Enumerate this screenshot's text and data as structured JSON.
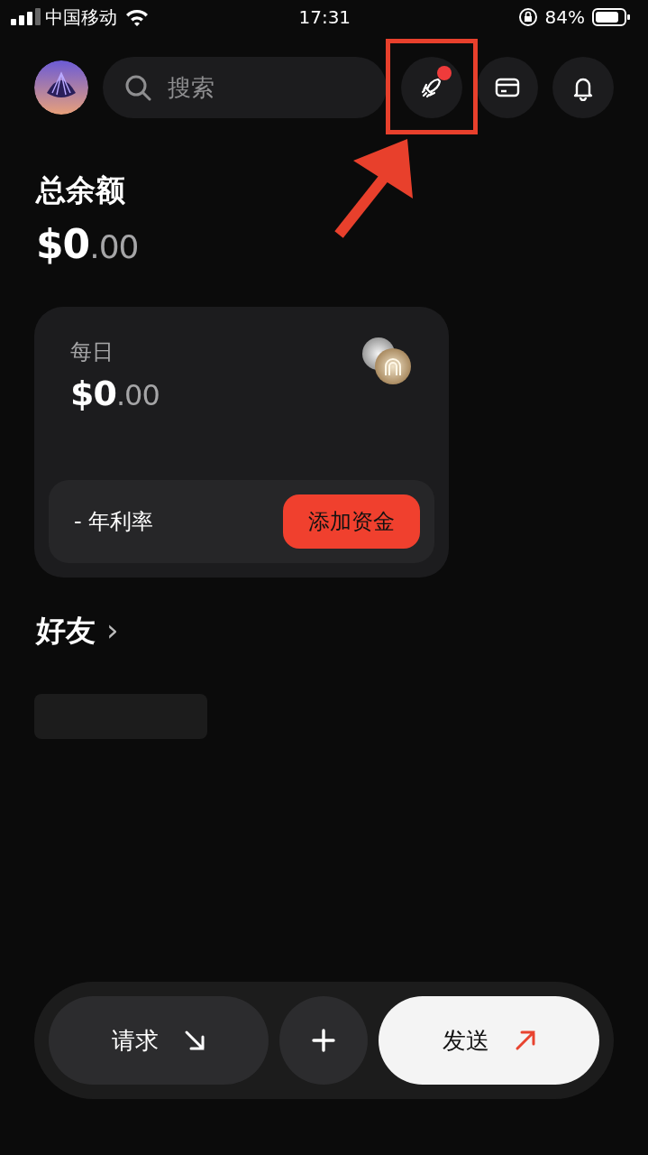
{
  "status_bar": {
    "carrier": "中国移动",
    "time": "17:31",
    "battery": "84%"
  },
  "header": {
    "search": {
      "placeholder": "搜索"
    },
    "icons": [
      {
        "kind": "rocket",
        "badge": true
      },
      {
        "kind": "card",
        "badge": false
      },
      {
        "kind": "bell",
        "badge": false
      }
    ]
  },
  "balance": {
    "title": "总余额",
    "whole": "$0",
    "cents": ".00"
  },
  "savings_card": {
    "label": "每日",
    "whole": "$0",
    "cents": ".00",
    "rate": "- 年利率",
    "button": "添加资金"
  },
  "friends": {
    "title": "好友",
    "chevron": "›"
  },
  "actions": [
    {
      "kind": "request",
      "label": "请求"
    },
    {
      "kind": "add"
    },
    {
      "kind": "send",
      "label": "发送"
    }
  ],
  "annotation": {
    "highlight_frame": true,
    "arrow": true
  }
}
